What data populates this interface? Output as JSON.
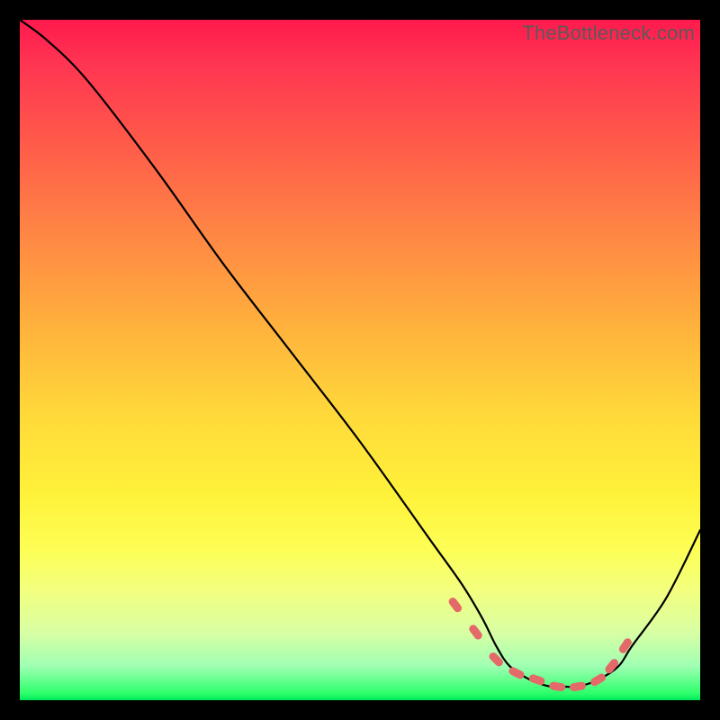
{
  "watermark": "TheBottleneck.com",
  "chart_data": {
    "type": "line",
    "title": "",
    "xlabel": "",
    "ylabel": "",
    "xlim": [
      0,
      100
    ],
    "ylim": [
      0,
      100
    ],
    "series": [
      {
        "name": "bottleneck-curve",
        "x": [
          0,
          4,
          10,
          20,
          30,
          40,
          50,
          60,
          65,
          68,
          70,
          72,
          75,
          78,
          80,
          82,
          85,
          88,
          90,
          95,
          100
        ],
        "y": [
          100,
          97,
          91,
          78,
          64,
          51,
          38,
          24,
          17,
          12,
          8,
          5,
          3,
          2,
          2,
          2,
          3,
          5,
          8,
          15,
          25
        ]
      }
    ],
    "markers": {
      "name": "optimal-range",
      "shape": "rounded-dash",
      "color": "#e46a6a",
      "x": [
        64,
        67,
        70,
        73,
        76,
        79,
        82,
        85,
        87,
        89
      ],
      "y": [
        14,
        10,
        6,
        4,
        3,
        2,
        2,
        3,
        5,
        8
      ]
    },
    "background": "red-yellow-green vertical gradient (red top, green bottom)"
  }
}
